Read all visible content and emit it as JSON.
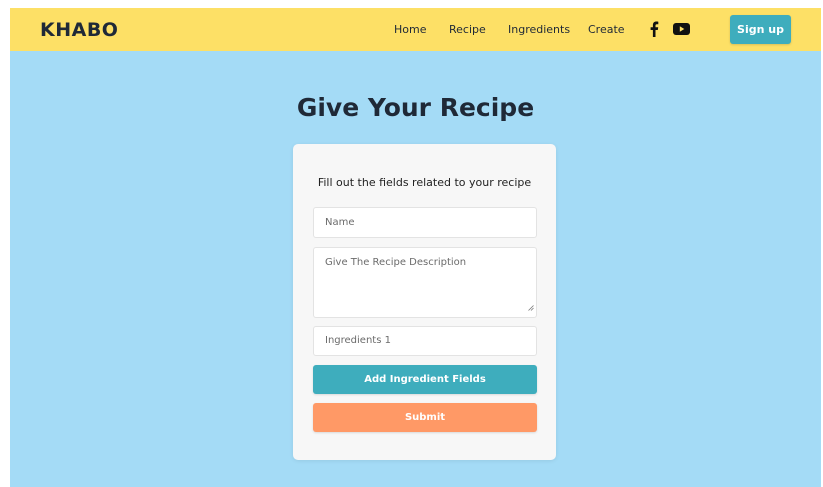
{
  "navbar": {
    "logo": "KHABO",
    "links": [
      {
        "label": "Home"
      },
      {
        "label": "Recipe"
      },
      {
        "label": "Ingredients"
      },
      {
        "label": "Create"
      }
    ],
    "social_icons": [
      "facebook-icon",
      "youtube-icon"
    ],
    "signup_label": "Sign up"
  },
  "main": {
    "title": "Give Your Recipe",
    "form": {
      "subtitle": "Fill out the fields related to your recipe",
      "name_placeholder": "Name",
      "description_placeholder": "Give The Recipe Description",
      "ingredient_placeholder": "Ingredients 1",
      "add_button_label": "Add Ingredient Fields",
      "submit_label": "Submit"
    }
  },
  "colors": {
    "navbar_bg": "#fde066",
    "page_bg": "#a4dbf6",
    "accent_teal": "#3eadbd",
    "submit_orange": "#ff9966",
    "card_bg": "#f7f7f7"
  }
}
